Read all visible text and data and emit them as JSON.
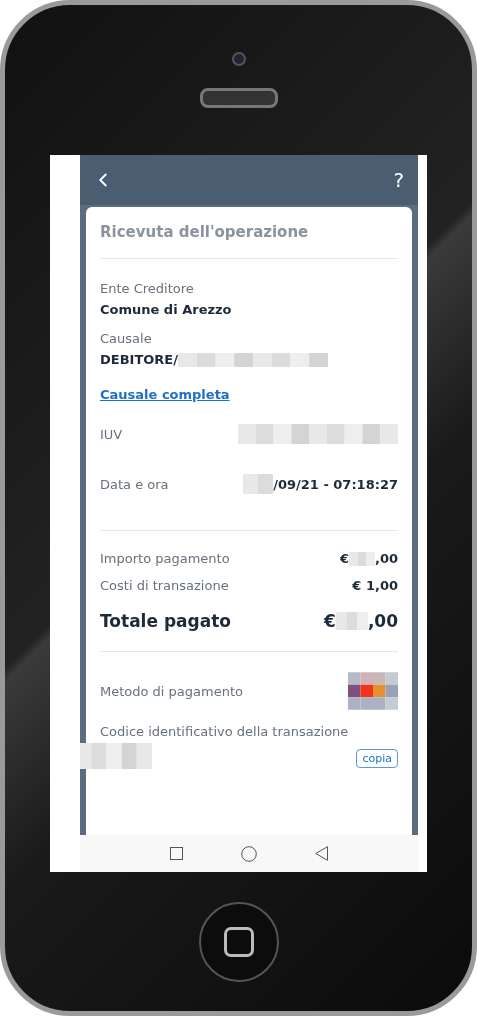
{
  "header": {
    "help": "?"
  },
  "receipt": {
    "title": "Ricevuta dell'operazione",
    "sections": [
      {
        "rows": [
          {
            "kind": "stacked",
            "label": "Ente Creditore",
            "value": "Comune di Arezzo",
            "redacted": false
          },
          {
            "kind": "stacked",
            "label": "Causale",
            "value": "DEBITORE/",
            "redacted": true
          },
          {
            "kind": "link",
            "label": "Causale completa"
          },
          {
            "kind": "inline",
            "label": "IUV",
            "redacted": true
          },
          {
            "kind": "inline",
            "label": "Data e ora",
            "value": "/09/21 - 07:18:27",
            "redacted": true
          }
        ]
      },
      {
        "rows": [
          {
            "kind": "amount",
            "label": "Importo pagamento",
            "prefix": "€",
            "suffix": ",00"
          },
          {
            "kind": "amount",
            "label": "Costi di transazione",
            "value": "€ 1,00"
          },
          {
            "kind": "total",
            "label": "Totale pagato",
            "prefix": "€",
            "suffix": ",00"
          }
        ]
      },
      {
        "rows": [
          {
            "kind": "method",
            "label": "Metodo di pagamento"
          },
          {
            "kind": "code",
            "label": "Codice identificativo della transazione",
            "button": "copia"
          }
        ]
      }
    ]
  }
}
